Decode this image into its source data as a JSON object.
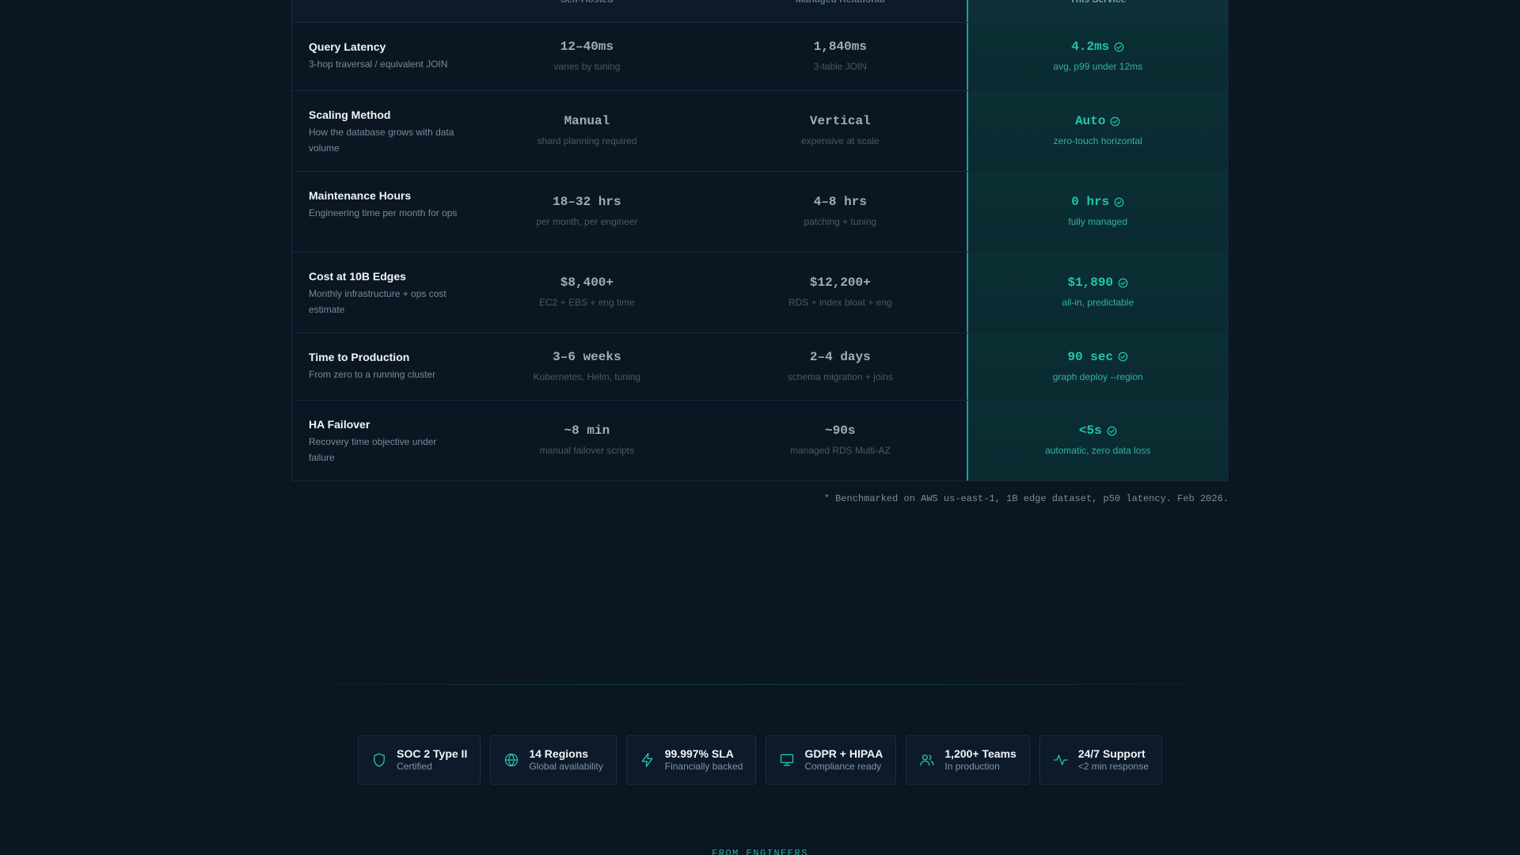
{
  "table": {
    "headers": [
      "",
      "Self-Hosted",
      "Managed Relational",
      "This Service"
    ],
    "rows": [
      {
        "title": "Query Latency",
        "desc": "3-hop traversal / equivalent JOIN",
        "self": {
          "value": "12–40ms",
          "note": "varies by tuning"
        },
        "managed": {
          "value": "1,840ms",
          "note": "3-table JOIN"
        },
        "service": {
          "value": "4.2ms",
          "note": "avg, p99 under 12ms"
        }
      },
      {
        "title": "Scaling Method",
        "desc": "How the database grows with data volume",
        "self": {
          "value": "Manual",
          "note": "shard planning required"
        },
        "managed": {
          "value": "Vertical",
          "note": "expensive at scale"
        },
        "service": {
          "value": "Auto",
          "note": "zero-touch horizontal"
        }
      },
      {
        "title": "Maintenance Hours",
        "desc": "Engineering time per month for ops",
        "self": {
          "value": "18–32 hrs",
          "note": "per month, per engineer"
        },
        "managed": {
          "value": "4–8 hrs",
          "note": "patching + tuning"
        },
        "service": {
          "value": "0 hrs",
          "note": "fully managed"
        }
      },
      {
        "title": "Cost at 10B Edges",
        "desc": "Monthly infrastructure + ops cost estimate",
        "self": {
          "value": "$8,400+",
          "note": "EC2 + EBS + eng time"
        },
        "managed": {
          "value": "$12,200+",
          "note": "RDS + index bloat + eng"
        },
        "service": {
          "value": "$1,890",
          "note": "all-in, predictable"
        }
      },
      {
        "title": "Time to Production",
        "desc": "From zero to a running cluster",
        "self": {
          "value": "3–6 weeks",
          "note": "Kubernetes, Helm, tuning"
        },
        "managed": {
          "value": "2–4 days",
          "note": "schema migration + joins"
        },
        "service": {
          "value": "90 sec",
          "note": "graph deploy --region"
        }
      },
      {
        "title": "HA Failover",
        "desc": "Recovery time objective under failure",
        "self": {
          "value": "~8 min",
          "note": "manual failover scripts"
        },
        "managed": {
          "value": "~90s",
          "note": "managed RDS Multi-AZ"
        },
        "service": {
          "value": "<5s",
          "note": "automatic, zero data loss"
        }
      }
    ],
    "footnote": "* Benchmarked on AWS us-east-1, 1B edge dataset, p50 latency. Feb 2026."
  },
  "badges": [
    {
      "icon": "shield-icon",
      "title": "SOC 2 Type II",
      "sub": "Certified"
    },
    {
      "icon": "globe-icon",
      "title": "14 Regions",
      "sub": "Global availability"
    },
    {
      "icon": "bolt-icon",
      "title": "99.997% SLA",
      "sub": "Financially backed"
    },
    {
      "icon": "monitor-icon",
      "title": "GDPR + HIPAA",
      "sub": "Compliance ready"
    },
    {
      "icon": "users-icon",
      "title": "1,200+ Teams",
      "sub": "In production"
    },
    {
      "icon": "activity-icon",
      "title": "24/7 Support",
      "sub": "<2 min response"
    }
  ],
  "eyebrow": "FROM ENGINEERS",
  "colors": {
    "background": "#0a1622",
    "accent": "#22c5ad",
    "highlight_column": "#0b2f33",
    "border": "#16283a"
  }
}
